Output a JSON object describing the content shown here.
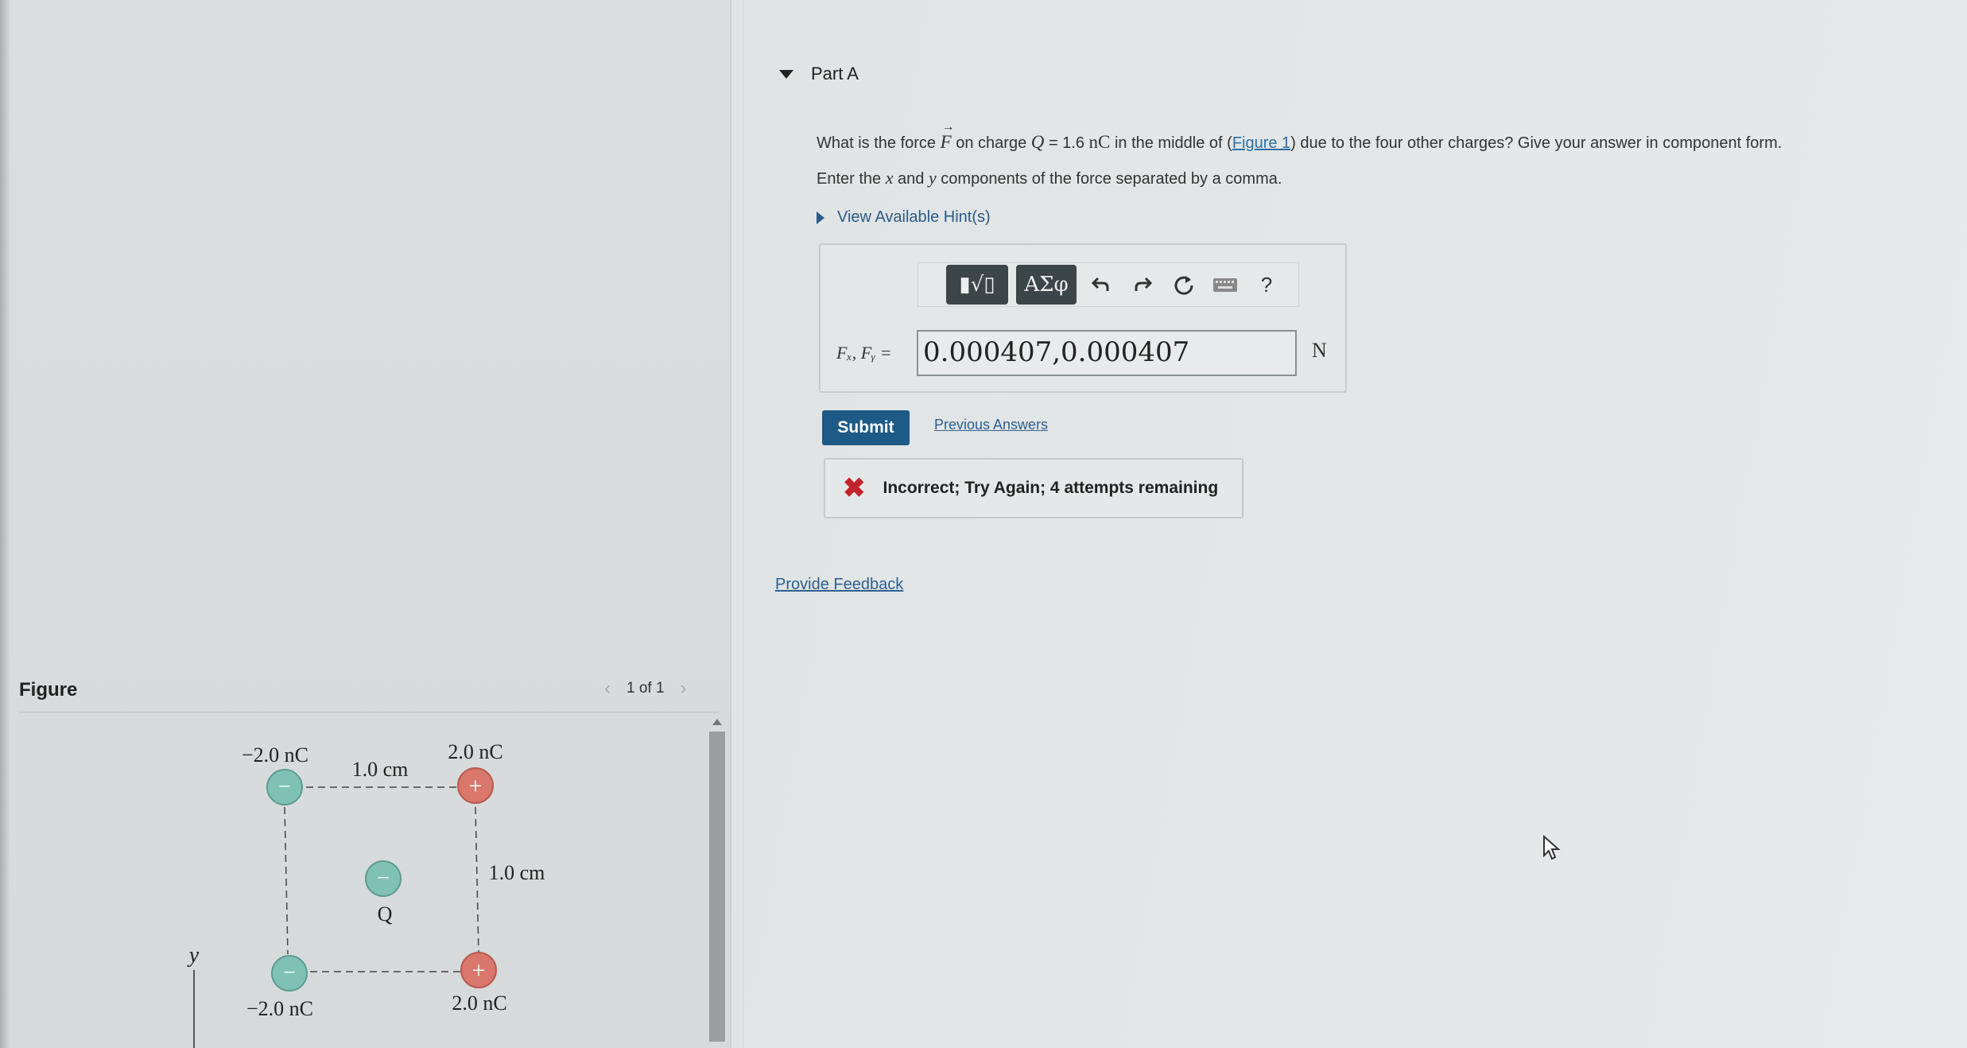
{
  "part": {
    "title": "Part A"
  },
  "question": {
    "prefix": "What is the force ",
    "force_symbol": "F",
    "on_charge": " on charge ",
    "charge_symbol": "Q",
    "charge_eq": " = 1.6 ",
    "charge_unit": "nC",
    "middle_of": " in the middle of (",
    "figure_link": "Figure 1",
    "suffix": ") due to the four other charges? Give your answer in component form."
  },
  "instruction": {
    "part1": "Enter the ",
    "x": "x",
    "part2": " and ",
    "y": "y",
    "part3": " components of the force separated by a comma."
  },
  "hints": {
    "label": "View Available Hint(s)"
  },
  "toolbar": {
    "template_label": "▮√▯",
    "greek_label": "ΑΣφ",
    "undo_icon": "undo-icon",
    "redo_icon": "redo-icon",
    "reset_icon": "reset-icon",
    "keyboard_icon": "keyboard-icon",
    "help_label": "?"
  },
  "answer": {
    "variable_label": "Fₓ, Fᵧ =",
    "value": "0.000407,0.000407",
    "unit": "N"
  },
  "buttons": {
    "submit": "Submit",
    "previous_answers": "Previous Answers"
  },
  "feedback": {
    "icon": "x-icon",
    "message": "Incorrect; Try Again; 4 attempts remaining"
  },
  "provide_feedback": "Provide Feedback",
  "figure": {
    "label": "Figure",
    "pager": "1 of 1",
    "charges": {
      "top_left": "−2.0 nC",
      "top_right": "2.0 nC",
      "bottom_left": "−2.0 nC",
      "bottom_right": "2.0 nC",
      "center": "Q"
    },
    "dimensions": {
      "horizontal": "1.0 cm",
      "vertical": "1.0 cm"
    },
    "axis_label": "y",
    "sign_minus": "−",
    "sign_plus": "+"
  },
  "colors": {
    "negative_charge": "#7fc2b5",
    "positive_charge": "#d9776c",
    "submit_bg": "#1d5a86",
    "link": "#2f6fa8",
    "error": "#c0242c"
  }
}
